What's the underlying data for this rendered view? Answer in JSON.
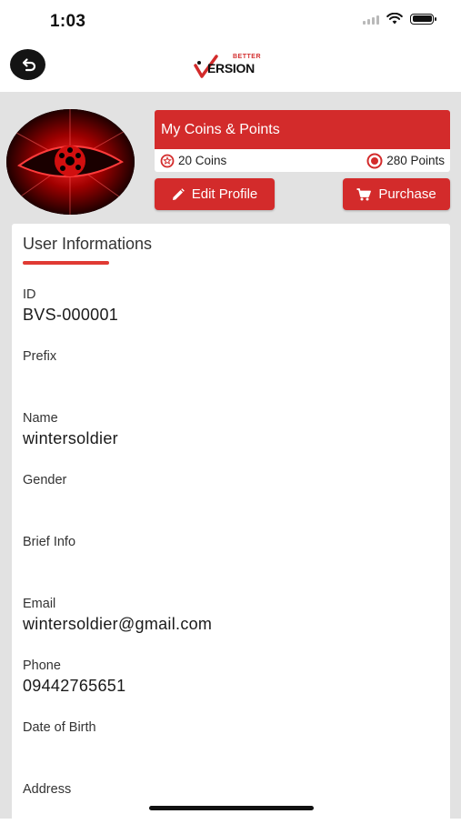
{
  "status_bar": {
    "time": "1:03"
  },
  "header": {
    "logo_top": "BETTER",
    "logo_main": "ERSION"
  },
  "coins_card": {
    "title": "My Coins & Points",
    "coins": "20 Coins",
    "points": "280 Points"
  },
  "buttons": {
    "edit_profile": "Edit Profile",
    "purchase": "Purchase"
  },
  "user_info": {
    "heading": "User Informations",
    "fields": [
      {
        "label": "ID",
        "value": "BVS-000001"
      },
      {
        "label": "Prefix",
        "value": ""
      },
      {
        "label": "Name",
        "value": "wintersoldier"
      },
      {
        "label": "Gender",
        "value": ""
      },
      {
        "label": "Brief Info",
        "value": ""
      },
      {
        "label": "Email",
        "value": "wintersoldier@gmail.com"
      },
      {
        "label": "Phone",
        "value": "09442765651"
      },
      {
        "label": "Date of Birth",
        "value": ""
      },
      {
        "label": "Address",
        "value": ""
      }
    ]
  },
  "colors": {
    "accent": "#d32b2b",
    "background": "#e2e2e2"
  },
  "icons": [
    "back-icon",
    "wifi-icon",
    "battery-icon",
    "coin-icon",
    "points-icon",
    "pencil-icon",
    "cart-icon"
  ]
}
